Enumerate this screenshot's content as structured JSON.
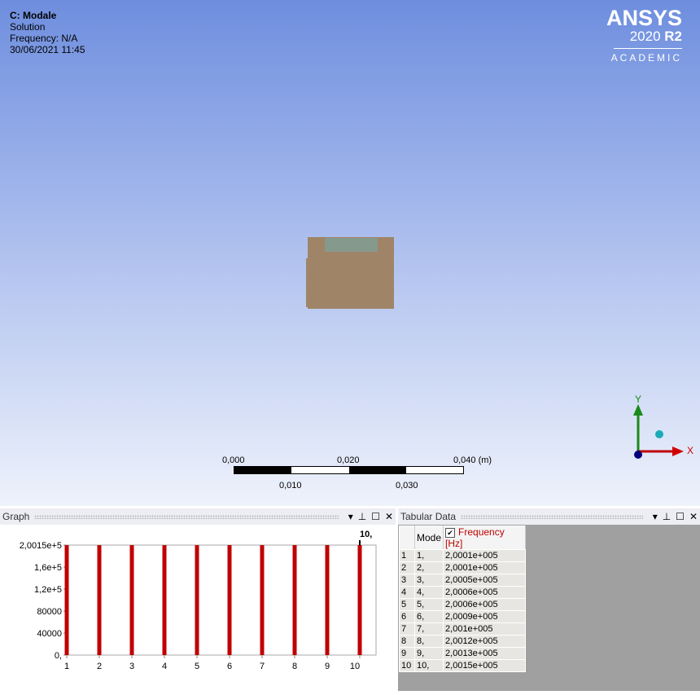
{
  "viewport": {
    "info": [
      "C: Modale",
      "Solution",
      "Frequency: N/A",
      "30/06/2021 11:45"
    ],
    "logo": {
      "brand": "ANSYS",
      "version": "2020",
      "release": "R2",
      "edition": "ACADEMIC"
    },
    "scale": {
      "top_labels": [
        "0,000",
        "0,020",
        "0,040 (m)"
      ],
      "bottom_labels": [
        "0,010",
        "0,030"
      ]
    },
    "axes": {
      "x": "X",
      "y": "Y"
    }
  },
  "graph": {
    "title": "Graph"
  },
  "tabular": {
    "title": "Tabular Data",
    "headers": [
      "Mode",
      "Frequency [Hz]"
    ],
    "rows": [
      [
        "1",
        "1,",
        "2,0001e+005"
      ],
      [
        "2",
        "2,",
        "2,0001e+005"
      ],
      [
        "3",
        "3,",
        "2,0005e+005"
      ],
      [
        "4",
        "4,",
        "2,0006e+005"
      ],
      [
        "5",
        "5,",
        "2,0006e+005"
      ],
      [
        "6",
        "6,",
        "2,0009e+005"
      ],
      [
        "7",
        "7,",
        "2,001e+005"
      ],
      [
        "8",
        "8,",
        "2,0012e+005"
      ],
      [
        "9",
        "9,",
        "2,0013e+005"
      ],
      [
        "10",
        "10,",
        "2,0015e+005"
      ]
    ]
  },
  "chart_data": {
    "type": "bar",
    "title": "",
    "categories": [
      "1",
      "2",
      "3",
      "4",
      "5",
      "6",
      "7",
      "8",
      "9",
      "10"
    ],
    "values": [
      200010,
      200010,
      200050,
      200060,
      200060,
      200090,
      200100,
      200120,
      200130,
      200150
    ],
    "ylim": [
      0,
      200150
    ],
    "yticks": [
      "2,0015e+5",
      "1,6e+5",
      "1,2e+5",
      "80000",
      "40000",
      "0,"
    ],
    "ytick_values": [
      200150,
      160000,
      120000,
      80000,
      40000,
      0
    ],
    "annotation": "10,",
    "bar_color": "#c00000"
  }
}
